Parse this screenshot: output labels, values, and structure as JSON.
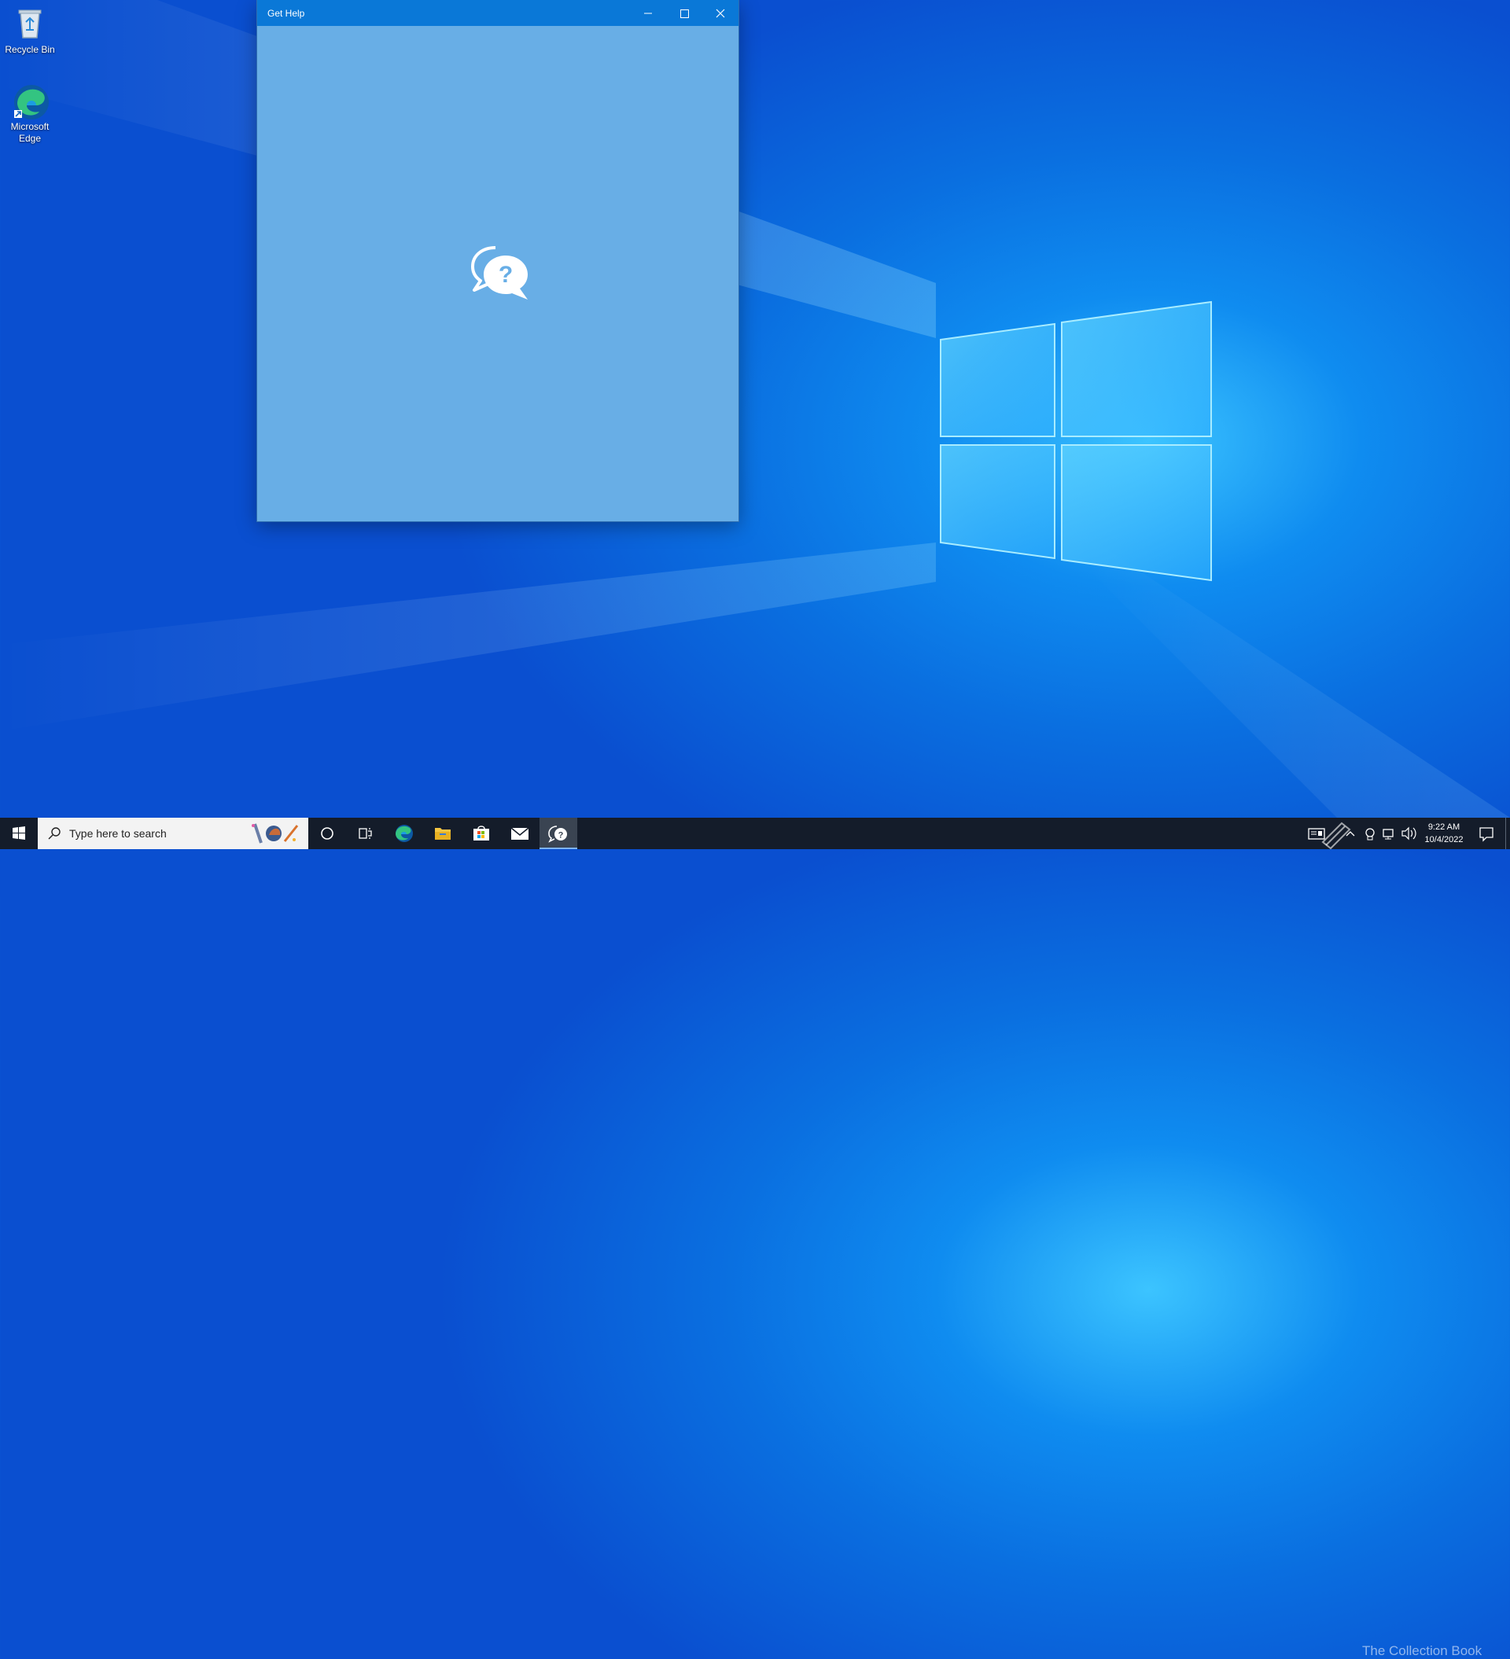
{
  "desktop": {
    "icons": [
      {
        "label": "Recycle Bin"
      },
      {
        "label": "Microsoft Edge"
      }
    ]
  },
  "window": {
    "title": "Get Help"
  },
  "taskbar": {
    "search_placeholder": "Type here to search",
    "clock_time": "9:22 AM",
    "clock_date": "10/4/2022",
    "watermark": "The Collection Book"
  },
  "colors": {
    "titlebar": "#0a78d7",
    "window_body": "#68aee6",
    "taskbar": "#141c2a"
  }
}
